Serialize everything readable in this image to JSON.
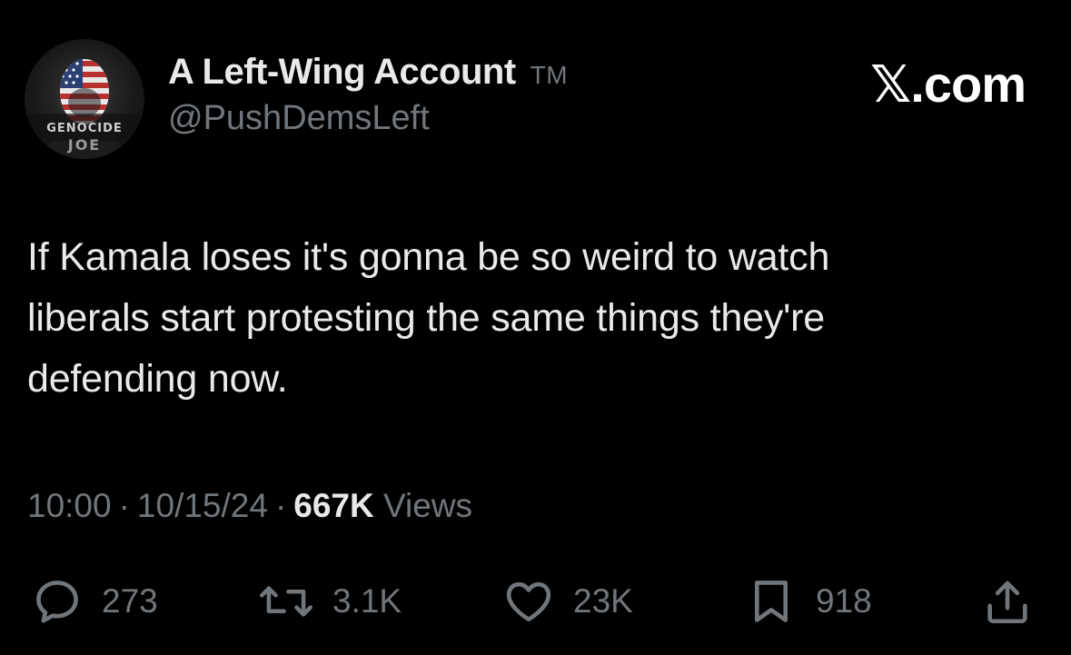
{
  "author": {
    "display_name": "A Left-Wing Account",
    "badge": "TM",
    "handle": "@PushDemsLeft",
    "avatar_text": "GENOCIDE JOE"
  },
  "brand": {
    "logo_text": "𝕏.com"
  },
  "tweet": {
    "text_lines": [
      "If Kamala loses it's gonna be so weird to watch",
      "liberals start protesting the same things they're",
      "defending now."
    ]
  },
  "meta": {
    "time": "10:00",
    "separator": "·",
    "date": "10/15/24",
    "views_count": "667K",
    "views_label": "Views"
  },
  "actions": {
    "replies": "273",
    "reposts": "3.1K",
    "likes": "23K",
    "bookmarks": "918"
  },
  "icons": {
    "reply": "reply-icon",
    "repost": "repost-icon",
    "like": "heart-icon",
    "bookmark": "bookmark-icon",
    "share": "share-icon"
  },
  "colors": {
    "background": "#000000",
    "primary_text": "#e7e9ea",
    "secondary_text": "#71767b"
  }
}
